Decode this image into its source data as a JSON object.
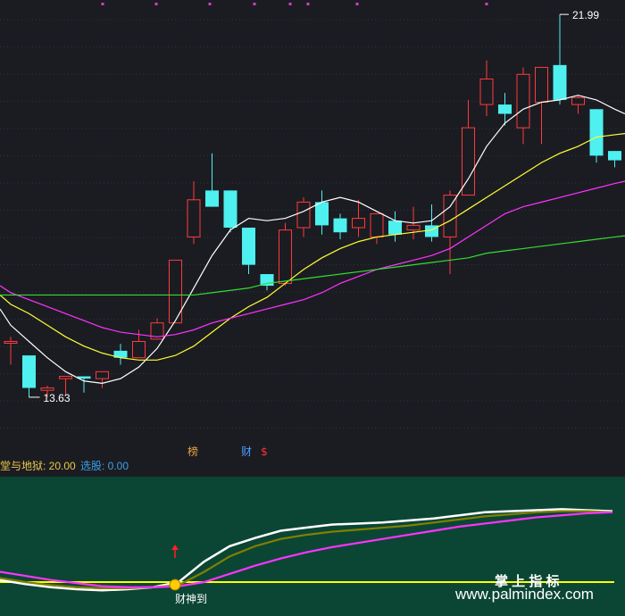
{
  "chart_data": [
    {
      "type": "candlestick",
      "ylim": [
        12.5,
        22.3
      ],
      "grid": true,
      "annotations": {
        "high_label": "21.99",
        "low_label": "13.63"
      },
      "markers": [
        "榜",
        "财",
        "$"
      ],
      "candles": [
        {
          "o": 14.95,
          "h": 15.05,
          "l": 14.45,
          "c": 14.95
        },
        {
          "o": 14.65,
          "h": 14.65,
          "l": 13.75,
          "c": 13.95
        },
        {
          "o": 13.9,
          "h": 14.0,
          "l": 13.75,
          "c": 13.95
        },
        {
          "o": 14.15,
          "h": 14.2,
          "l": 13.8,
          "c": 14.2
        },
        {
          "o": 14.2,
          "h": 14.2,
          "l": 13.85,
          "c": 14.15
        },
        {
          "o": 14.15,
          "h": 14.3,
          "l": 13.95,
          "c": 14.3
        },
        {
          "o": 14.75,
          "h": 14.9,
          "l": 14.45,
          "c": 14.6
        },
        {
          "o": 14.6,
          "h": 15.2,
          "l": 14.6,
          "c": 14.95
        },
        {
          "o": 15.0,
          "h": 15.45,
          "l": 15.0,
          "c": 15.35
        },
        {
          "o": 15.35,
          "h": 16.7,
          "l": 15.35,
          "c": 16.7
        },
        {
          "o": 17.2,
          "h": 18.4,
          "l": 17.05,
          "c": 18.0
        },
        {
          "o": 18.2,
          "h": 19.0,
          "l": 17.85,
          "c": 17.85
        },
        {
          "o": 18.2,
          "h": 18.2,
          "l": 17.3,
          "c": 17.4
        },
        {
          "o": 17.4,
          "h": 17.4,
          "l": 16.4,
          "c": 16.6
        },
        {
          "o": 16.4,
          "h": 16.4,
          "l": 16.05,
          "c": 16.15
        },
        {
          "o": 16.2,
          "h": 17.5,
          "l": 16.15,
          "c": 17.35
        },
        {
          "o": 17.4,
          "h": 18.05,
          "l": 17.2,
          "c": 17.95
        },
        {
          "o": 17.95,
          "h": 18.2,
          "l": 17.25,
          "c": 17.45
        },
        {
          "o": 17.6,
          "h": 17.7,
          "l": 17.15,
          "c": 17.3
        },
        {
          "o": 17.4,
          "h": 18.0,
          "l": 17.2,
          "c": 17.6
        },
        {
          "o": 17.2,
          "h": 17.6,
          "l": 17.05,
          "c": 17.7
        },
        {
          "o": 17.55,
          "h": 17.75,
          "l": 17.1,
          "c": 17.25
        },
        {
          "o": 17.35,
          "h": 17.85,
          "l": 17.15,
          "c": 17.45
        },
        {
          "o": 17.45,
          "h": 17.9,
          "l": 17.1,
          "c": 17.2
        },
        {
          "o": 17.2,
          "h": 18.2,
          "l": 16.4,
          "c": 18.1
        },
        {
          "o": 18.1,
          "h": 20.15,
          "l": 18.1,
          "c": 19.55
        },
        {
          "o": 20.05,
          "h": 21.0,
          "l": 19.8,
          "c": 20.6
        },
        {
          "o": 20.05,
          "h": 20.3,
          "l": 19.6,
          "c": 19.85
        },
        {
          "o": 19.55,
          "h": 20.85,
          "l": 19.2,
          "c": 20.7
        },
        {
          "o": 20.1,
          "h": 20.85,
          "l": 19.2,
          "c": 20.85
        },
        {
          "o": 20.9,
          "h": 21.99,
          "l": 20.05,
          "c": 20.15
        },
        {
          "o": 20.05,
          "h": 20.25,
          "l": 19.85,
          "c": 20.2
        },
        {
          "o": 19.95,
          "h": 19.95,
          "l": 18.8,
          "c": 18.95
        },
        {
          "o": 19.05,
          "h": 19.05,
          "l": 18.7,
          "c": 18.85
        }
      ],
      "ma_lines": [
        {
          "color": "#ffffff",
          "values": [
            15.3,
            14.95,
            14.6,
            14.3,
            14.1,
            14.05,
            14.15,
            14.4,
            14.8,
            15.4,
            16.1,
            16.8,
            17.35,
            17.6,
            17.55,
            17.6,
            17.75,
            17.95,
            18.05,
            17.95,
            17.75,
            17.55,
            17.5,
            17.55,
            17.85,
            18.45,
            19.15,
            19.65,
            19.95,
            20.1,
            20.15,
            20.25,
            20.15,
            19.95
          ]
        },
        {
          "color": "#ffff33",
          "values": [
            15.75,
            15.55,
            15.3,
            15.05,
            14.85,
            14.7,
            14.6,
            14.55,
            14.55,
            14.65,
            14.85,
            15.15,
            15.45,
            15.7,
            15.9,
            16.2,
            16.5,
            16.75,
            16.95,
            17.1,
            17.2,
            17.25,
            17.3,
            17.35,
            17.55,
            17.8,
            18.05,
            18.3,
            18.55,
            18.8,
            19.0,
            19.15,
            19.35,
            19.4
          ]
        },
        {
          "color": "#ff33ff",
          "values": [
            16.0,
            15.85,
            15.7,
            15.55,
            15.4,
            15.25,
            15.15,
            15.1,
            15.05,
            15.1,
            15.2,
            15.35,
            15.45,
            15.55,
            15.65,
            15.75,
            15.85,
            16.0,
            16.2,
            16.35,
            16.5,
            16.6,
            16.7,
            16.8,
            16.95,
            17.2,
            17.45,
            17.7,
            17.85,
            17.95,
            18.05,
            18.15,
            18.25,
            18.35
          ]
        },
        {
          "color": "#33dd33",
          "values": [
            15.95,
            15.95,
            15.95,
            15.95,
            15.95,
            15.95,
            15.95,
            15.95,
            15.95,
            15.95,
            15.95,
            16.0,
            16.05,
            16.1,
            16.2,
            16.25,
            16.3,
            16.35,
            16.4,
            16.45,
            16.5,
            16.55,
            16.6,
            16.65,
            16.7,
            16.75,
            16.85,
            16.9,
            16.95,
            17.0,
            17.05,
            17.1,
            17.15,
            17.2
          ]
        }
      ]
    },
    {
      "type": "line",
      "title": "堂与地狱: 20.00",
      "subtitle": "选股: 0.00",
      "ylim": [
        0,
        100
      ],
      "threshold": 20,
      "signal_label": "财神到",
      "series": [
        {
          "color": "#ffffff",
          "values": [
            22,
            18,
            15,
            13,
            12,
            13,
            15,
            20,
            40,
            55,
            63,
            70,
            73,
            76,
            77,
            78,
            80,
            82,
            85,
            88,
            89,
            90,
            91,
            90,
            89
          ]
        },
        {
          "color": "#808000",
          "values": [
            24,
            20,
            17,
            15,
            14,
            14,
            15,
            17,
            30,
            45,
            55,
            62,
            66,
            69,
            71,
            73,
            75,
            78,
            81,
            84,
            86,
            88,
            89,
            89,
            88
          ]
        },
        {
          "color": "#ff33ff",
          "values": [
            30,
            26,
            22,
            19,
            16,
            15,
            15,
            16,
            20,
            28,
            36,
            43,
            49,
            54,
            58,
            62,
            66,
            70,
            74,
            77,
            80,
            83,
            85,
            87,
            88
          ]
        }
      ]
    }
  ],
  "watermark": {
    "title": "掌 上 指 标",
    "url": "www.palmindex.com"
  }
}
